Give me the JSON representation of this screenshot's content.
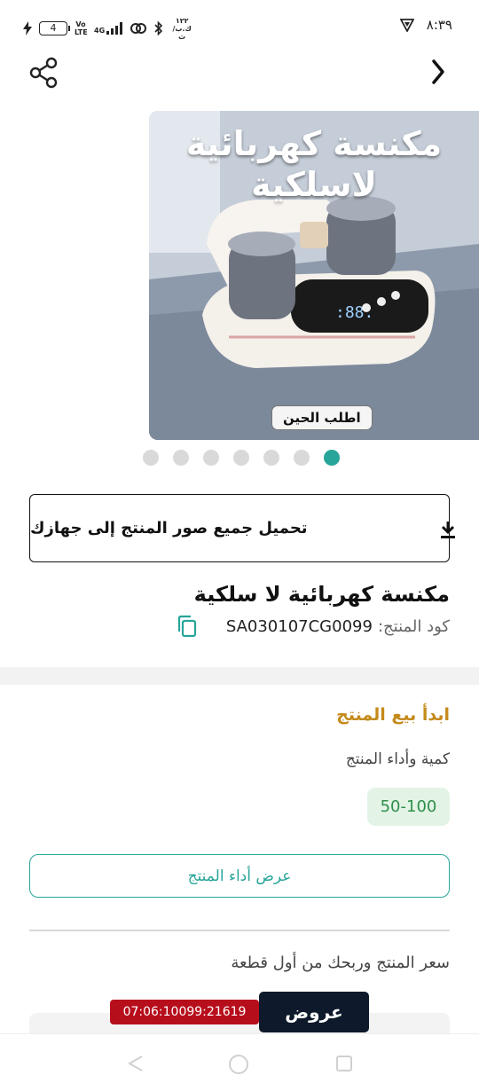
{
  "status_bar": {
    "battery_level": "4",
    "network": "4G",
    "volte": "Vo LTE",
    "data_speed": "١٢٢ ك.ب/ث",
    "time": "٨:٣٩"
  },
  "header": {
    "back_icon": "chevron-right-icon",
    "share_icon": "share-icon"
  },
  "product_image": {
    "title_line1": "مكنسة كهربائية",
    "title_line2": "لاسلكية",
    "badge": "اطلب الحين",
    "dot_count": 7,
    "active_dot": 6
  },
  "download": {
    "label": "تحميل جميع صور المنتج إلى جهازك",
    "icon": "download-icon"
  },
  "product": {
    "name": "مكنسة كهربائية لا سلكية",
    "code_label": "كود المنتج:",
    "code_value": "SA030107CG0099",
    "copy_icon": "copy-icon"
  },
  "selling": {
    "start_label": "ابدأ بيع المنتج",
    "qty_label": "كمية وأداء المنتج",
    "qty_range": "50-100",
    "performance_button": "عرض أداء المنتج",
    "price_label": "سعر المنتج وربحك من أول قطعة"
  },
  "offers": {
    "timer": "07:06:10099:21619",
    "label": "عروض"
  },
  "colors": {
    "accent": "#28a59a",
    "gold": "#c48a1b",
    "chip_bg": "#e3f4e6",
    "chip_text": "#2f8f4b",
    "timer_bg": "#b70e1c",
    "offers_bg": "#0e1a2b"
  }
}
